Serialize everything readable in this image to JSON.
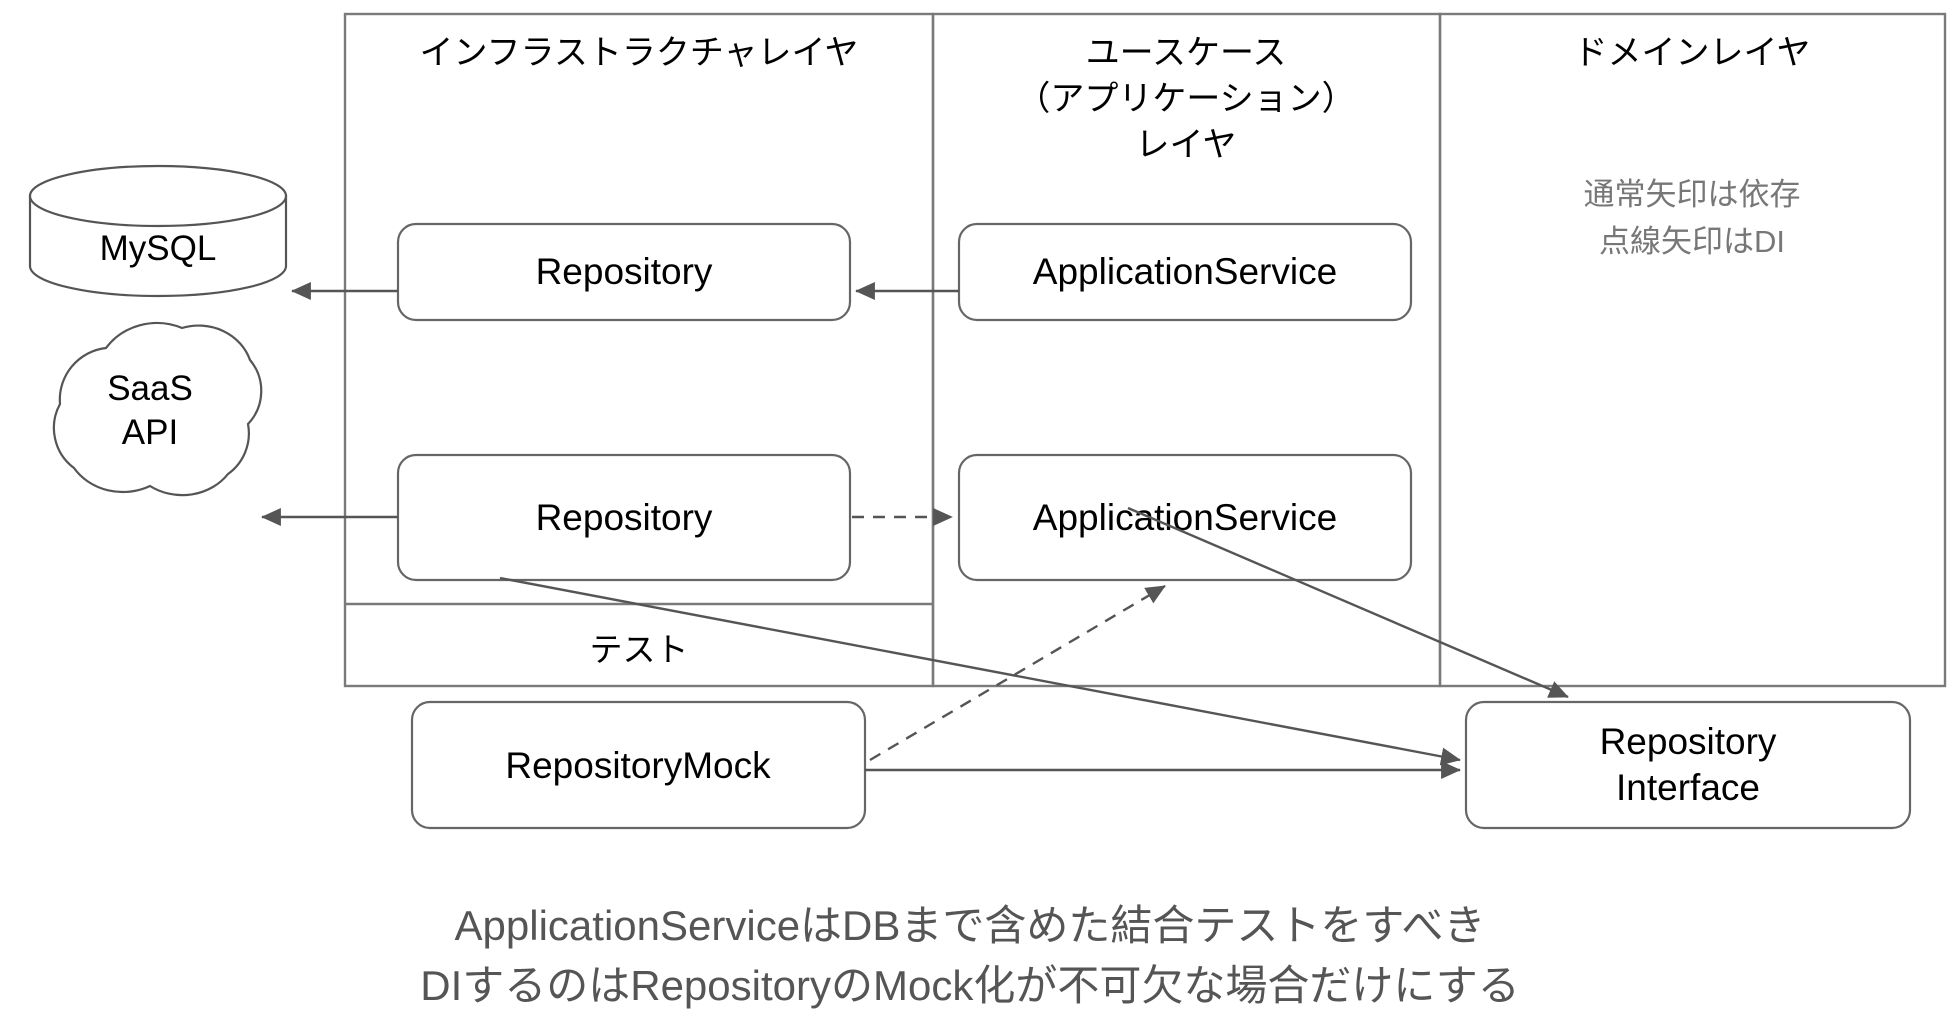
{
  "diagram": {
    "title_present": false,
    "layers": [
      {
        "id": "infrastructure",
        "label": "インフラストラクチャレイヤ"
      },
      {
        "id": "usecase",
        "label_line1": "ユースケース",
        "label_line2": "（アプリケーション）",
        "label_line3": "レイヤ"
      },
      {
        "id": "domain",
        "label": "ドメインレイヤ"
      }
    ],
    "sections": [
      {
        "id": "test",
        "label": "テスト"
      }
    ],
    "legend": {
      "line1": "通常矢印は依存",
      "line2": "点線矢印はDI",
      "color": "#777777"
    },
    "stores": [
      {
        "id": "mysql",
        "label": "MySQL",
        "shape": "cylinder"
      },
      {
        "id": "saas-api",
        "label_line1": "SaaS",
        "label_line2": "API",
        "shape": "cloud"
      }
    ],
    "nodes": [
      {
        "id": "repository-db",
        "label": "Repository",
        "layer": "infrastructure"
      },
      {
        "id": "repository-saas",
        "label": "Repository",
        "layer": "infrastructure"
      },
      {
        "id": "repository-mock",
        "label": "RepositoryMock",
        "layer": "infrastructure-test"
      },
      {
        "id": "application-service-1",
        "label": "ApplicationService",
        "layer": "usecase"
      },
      {
        "id": "application-service-2",
        "label": "ApplicationService",
        "layer": "usecase"
      },
      {
        "id": "repository-interface",
        "label_line1": "Repository",
        "label_line2": "Interface",
        "layer": "domain"
      }
    ],
    "edges": [
      {
        "from": "repository-db",
        "to": "mysql",
        "style": "solid"
      },
      {
        "from": "application-service-1",
        "to": "repository-db",
        "style": "solid"
      },
      {
        "from": "repository-saas",
        "to": "saas-api",
        "style": "solid"
      },
      {
        "from": "repository-saas",
        "to": "application-service-2",
        "style": "dashed"
      },
      {
        "from": "repository-saas",
        "to": "repository-interface",
        "style": "solid"
      },
      {
        "from": "application-service-2",
        "to": "repository-interface",
        "style": "solid"
      },
      {
        "from": "repository-mock",
        "to": "application-service-2",
        "style": "dashed"
      },
      {
        "from": "repository-mock",
        "to": "repository-interface",
        "style": "solid"
      }
    ],
    "caption": {
      "line1": "ApplicationServiceはDBまで含めた結合テストをすべき",
      "line2": "DIするのはRepositoryのMock化が不可欠な場合だけにする"
    },
    "colors": {
      "stroke": "#666666",
      "edge": "#555555",
      "text": "#000000",
      "muted": "#777777",
      "caption": "#555555",
      "background": "#ffffff"
    }
  }
}
